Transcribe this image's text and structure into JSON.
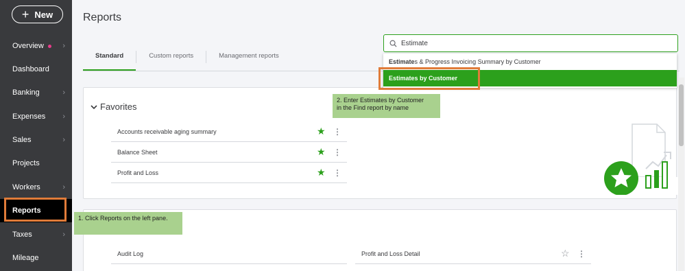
{
  "sidebar": {
    "new_label": "New",
    "items": [
      {
        "label": "Overview",
        "chevron": true,
        "dot": true
      },
      {
        "label": "Dashboard",
        "chevron": false
      },
      {
        "label": "Banking",
        "chevron": true
      },
      {
        "label": "Expenses",
        "chevron": true
      },
      {
        "label": "Sales",
        "chevron": true
      },
      {
        "label": "Projects",
        "chevron": false
      },
      {
        "label": "Workers",
        "chevron": true
      },
      {
        "label": "Reports",
        "chevron": false,
        "active": true
      },
      {
        "label": "Taxes",
        "chevron": true
      },
      {
        "label": "Mileage",
        "chevron": false
      }
    ]
  },
  "header": {
    "title": "Reports",
    "tabs": [
      "Standard",
      "Custom reports",
      "Management reports"
    ]
  },
  "search": {
    "value": "Estimate",
    "results": [
      {
        "match": "Estimate",
        "rest": "s & Progress Invoicing Summary by Customer"
      },
      {
        "label": "Estimates by Customer"
      }
    ]
  },
  "favorites": {
    "title": "Favorites",
    "items": [
      "Accounts receivable aging summary",
      "Balance Sheet",
      "Profit and Loss"
    ]
  },
  "section2": {
    "items": [
      "Audit Log",
      "Profit and Loss Detail"
    ]
  },
  "callouts": {
    "step1": "1. Click Reports on the left pane.",
    "step2_line1": "2.  Enter Estimates by Customer",
    "step2_line2": "in the Find report by name"
  },
  "colors": {
    "accent": "#2ca01c",
    "sidebar": "#393a3d",
    "highlight": "#e07b39",
    "callout": "#a9d18e"
  }
}
